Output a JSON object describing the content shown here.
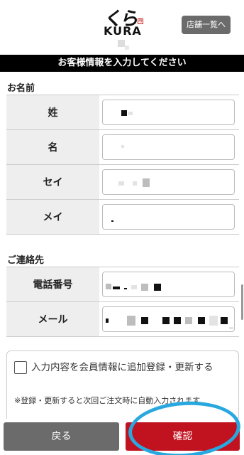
{
  "header": {
    "logo_text": "くら",
    "logo_sub": "KURA",
    "logo_seal": "寿司",
    "store_list_button": "店舗一覧へ"
  },
  "title_bar": "お客様情報を入力してください",
  "name_section": {
    "label": "お名前",
    "rows": [
      {
        "label": "姓"
      },
      {
        "label": "名"
      },
      {
        "label": "セイ"
      },
      {
        "label": "メイ"
      }
    ]
  },
  "contact_section": {
    "label": "ご連絡先",
    "rows": [
      {
        "label": "電話番号"
      },
      {
        "label": "メール"
      }
    ]
  },
  "member_option": {
    "checkbox_label": "入力内容を会員情報に追加登録・更新する",
    "checked": false,
    "note": "※登録・更新すると次回ご注文時に自動入力されます"
  },
  "buttons": {
    "back": "戻る",
    "confirm": "確認"
  },
  "colors": {
    "title_bar_bg": "#000000",
    "confirm_button": "#c1121f",
    "back_button": "#6b6b6b",
    "annotation_circle": "#29a8df"
  }
}
